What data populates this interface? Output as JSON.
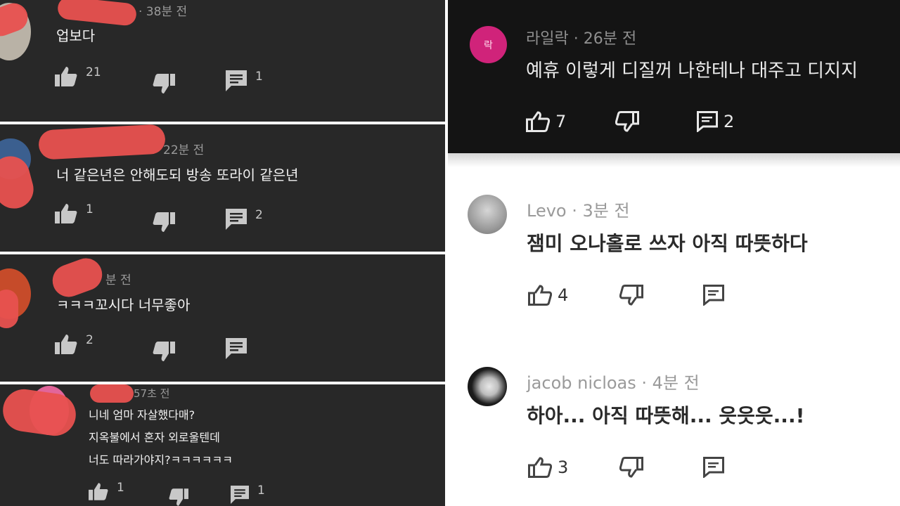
{
  "left_comments": [
    {
      "time": "· 38분 전",
      "text": "업보다",
      "likes": "21",
      "replies": "1"
    },
    {
      "time": "22분 전",
      "text": "너 같은년은 안해도되 방송 또라이 같은년",
      "likes": "1",
      "replies": "2"
    },
    {
      "time": "분 전",
      "text": "ㅋㅋㅋ꼬시다 너무좋아",
      "likes": "2",
      "replies": ""
    },
    {
      "time": "57초 전",
      "lines": [
        "니네 엄마 자살했다매?",
        "지옥불에서 혼자 외로울텐데",
        "너도 따라가야지?ㅋㅋㅋㅋㅋㅋ"
      ],
      "likes": "1",
      "replies": "1"
    }
  ],
  "right_comments": [
    {
      "avatar_letter": "락",
      "author": "라일락",
      "time": "· 26분 전",
      "text": "예휴 이렇게 디질꺼 나한테나 대주고 디지지",
      "likes": "7",
      "replies": "2"
    },
    {
      "author": "Levo",
      "time": "· 3분 전",
      "text": "잼미 오나홀로 쓰자 아직 따뜻하다",
      "likes": "4"
    },
    {
      "author": "jacob nicloas",
      "time": "· 4분 전",
      "text": "하아... 아직 따뜻해... 읏읏읏...!",
      "likes": "3"
    }
  ],
  "colors": {
    "dark_card": "#282828",
    "redaction": "#e8514f",
    "lilac_avatar": "#d0237a"
  },
  "icons": [
    "thumbs-up-icon",
    "thumbs-down-icon",
    "reply-icon"
  ]
}
